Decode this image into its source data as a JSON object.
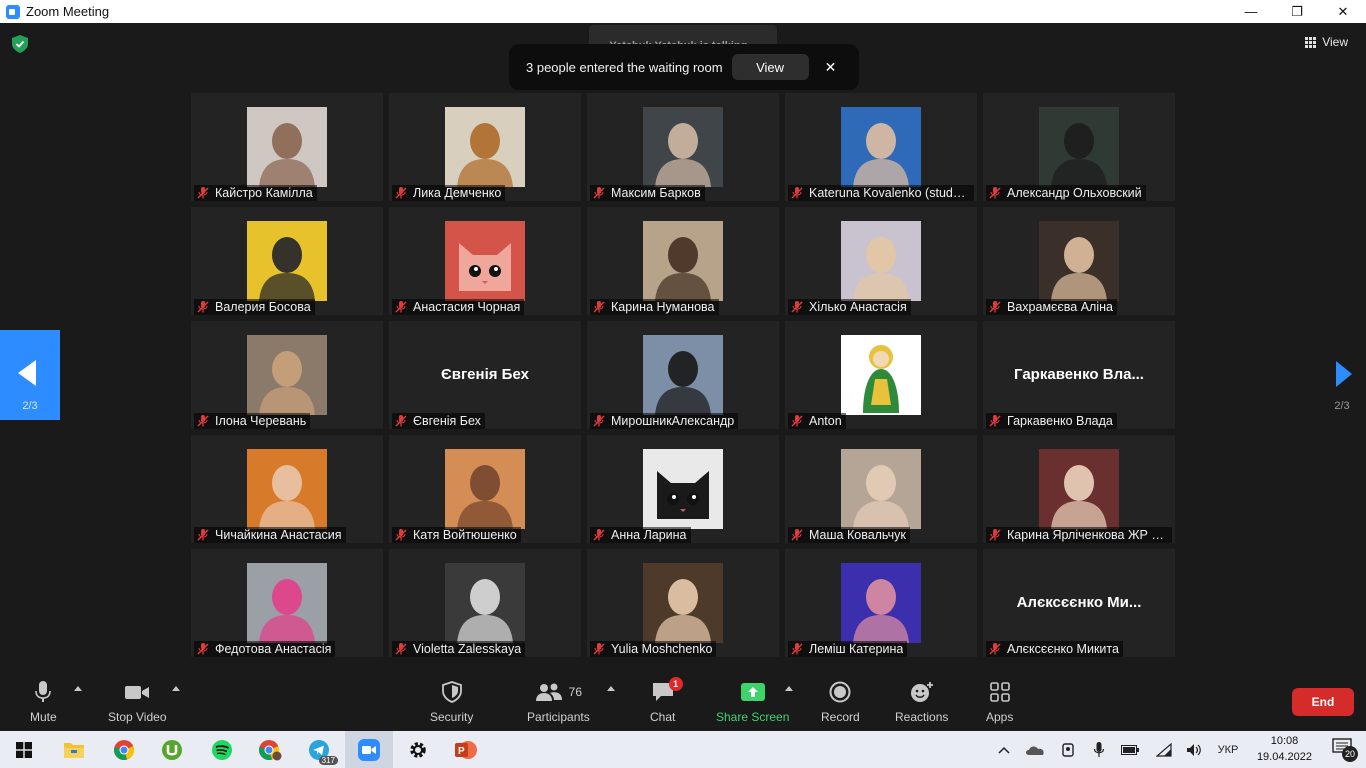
{
  "window": {
    "title": "Zoom Meeting",
    "controls": {
      "minimize": "—",
      "maximize": "❐",
      "close": "✕"
    }
  },
  "meeting": {
    "view_label": "View",
    "talking_text": "Yatchuk Yatchuk is talking...",
    "waiting_room": {
      "message": "3 people entered the waiting room",
      "view_button": "View",
      "close": "✕"
    },
    "page_left": "2/3",
    "page_right": "2/3"
  },
  "participants": [
    {
      "name": "Кайстро Камілла",
      "photo": "person",
      "bg": "#cfc7c2",
      "fg": "#8d6a55"
    },
    {
      "name": "Лика Демченко",
      "photo": "person",
      "bg": "#d9cfbf",
      "fg": "#b0702f"
    },
    {
      "name": "Максим Барков",
      "photo": "person",
      "bg": "#3f4548",
      "fg": "#c9b3a0"
    },
    {
      "name": "Kateruna Kovalenko (stude...",
      "photo": "person",
      "bg": "#2f6ab8",
      "fg": "#d8b9a2"
    },
    {
      "name": "Александр Ольховский",
      "photo": "person",
      "bg": "#2f3a34",
      "fg": "#1e1e1e"
    },
    {
      "name": "Валерия Босова",
      "photo": "person",
      "bg": "#e7c22c",
      "fg": "#2a2a2a"
    },
    {
      "name": "Анастасия Чорная",
      "photo": "cat",
      "bg": "#d5544a",
      "fg": "#f0a79b"
    },
    {
      "name": "Карина Нуманова",
      "photo": "person",
      "bg": "#b7a28a",
      "fg": "#4a3527"
    },
    {
      "name": "Хілько  Анастасія",
      "photo": "person",
      "bg": "#c9c2cf",
      "fg": "#e3c7a5"
    },
    {
      "name": "Вахрамєєва Аліна",
      "photo": "person",
      "bg": "#3b2f2a",
      "fg": "#d8b89a"
    },
    {
      "name": "Ілона Черевань",
      "photo": "person",
      "bg": "#8b7a6a",
      "fg": "#c7a07a"
    },
    {
      "name": "Євгенія Бех",
      "photo": "none",
      "big": "Євгенія Бех"
    },
    {
      "name": "МирошникАлександр",
      "photo": "person",
      "bg": "#7c8fa6",
      "fg": "#1d1d1d"
    },
    {
      "name": "Anton",
      "photo": "icon",
      "bg": "#ffffff",
      "fg": "#2e8a3a"
    },
    {
      "name": "Гаркавенко Влада",
      "photo": "none",
      "big": "Гаркавенко  Вла..."
    },
    {
      "name": "Чичайкина Анастасия",
      "photo": "person",
      "bg": "#d77a2a",
      "fg": "#e8c2a4"
    },
    {
      "name": "Катя Войтюшенко",
      "photo": "person",
      "bg": "#d48d55",
      "fg": "#7a4a30"
    },
    {
      "name": "Анна Ларина",
      "photo": "cat",
      "bg": "#e9e9e9",
      "fg": "#1a1a1a"
    },
    {
      "name": "Маша Ковальчук",
      "photo": "person",
      "bg": "#b5a596",
      "fg": "#e4cbb5"
    },
    {
      "name": "Карина Ярліченкова ЖР 2...",
      "photo": "person",
      "bg": "#6a2f2f",
      "fg": "#e7cbb5"
    },
    {
      "name": "Федотова Анастасія",
      "photo": "person",
      "bg": "#9aa0a6",
      "fg": "#e0438a"
    },
    {
      "name": "Violetta Zalesskaya",
      "photo": "person",
      "bg": "#3a3a3a",
      "fg": "#d6d6d6"
    },
    {
      "name": "Yulia Moshchenko",
      "photo": "person",
      "bg": "#4d3a2a",
      "fg": "#e2c4a8"
    },
    {
      "name": "Леміш Катерина",
      "photo": "person",
      "bg": "#3b2fae",
      "fg": "#d68aa0"
    },
    {
      "name": "Алєксєєнко Микита",
      "photo": "none",
      "big": "Алєксєєнко  Ми..."
    }
  ],
  "toolbar": {
    "mute": "Mute",
    "stop_video": "Stop Video",
    "security": "Security",
    "participants": "Participants",
    "participants_count": "76",
    "chat": "Chat",
    "chat_badge": "1",
    "share_screen": "Share Screen",
    "record": "Record",
    "reactions": "Reactions",
    "apps": "Apps",
    "end": "End"
  },
  "taskbar": {
    "apps": [
      "windows-start",
      "file-explorer",
      "chrome",
      "utorrent",
      "spotify",
      "chrome-profile",
      "telegram",
      "zoom",
      "settings",
      "powerpoint"
    ],
    "telegram_badge": "317",
    "language": "УКР",
    "time": "10:08",
    "date": "19.04.2022",
    "notifications": "20"
  },
  "colors": {
    "accent": "#2D8CFF",
    "end_red": "#d52b2b",
    "share_green": "#3fd36b",
    "muted_red": "#e03b3b"
  }
}
